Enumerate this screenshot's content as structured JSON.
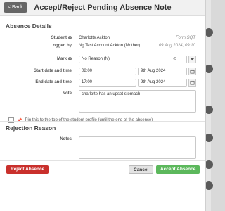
{
  "header": {
    "back_label": "< Back",
    "title": "Accept/Reject Pending Absence Note"
  },
  "absence_details": {
    "section_title": "Absence Details",
    "student_label": "Student",
    "student_value": "Charlotte Ackton",
    "student_form": "Form SQT",
    "logged_by_label": "Logged by",
    "logged_by_value": "Ng Test Account Ackton (Mother)",
    "logged_at": "09 Aug 2024, 09:10",
    "mark_label": "Mark",
    "mark_value": "No Reason (N)",
    "start_label": "Start date and time",
    "start_time": "08:00",
    "start_date": "9th Aug 2024",
    "end_label": "End date and time",
    "end_time": "17:00",
    "end_date": "9th Aug 2024",
    "note_label": "Note",
    "note_value": "charlotte has an upset stomach",
    "pin_label": "Pin this to the top of the student profile (until the end of the absence)"
  },
  "rejection": {
    "section_title": "Rejection Reason",
    "notes_label": "Notes",
    "notes_value": ""
  },
  "footer": {
    "reject_label": "Reject Absence",
    "cancel_label": "Cancel",
    "accept_label": "Accept Absence"
  },
  "colors": {
    "reject": "#c9302c",
    "accept": "#5cb85c",
    "back": "#666666"
  }
}
